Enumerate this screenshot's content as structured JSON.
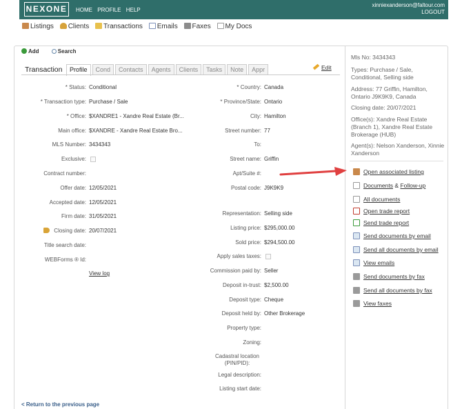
{
  "header": {
    "logo": "NEXONE",
    "nav": [
      "HOME",
      "PROFILE",
      "HELP"
    ],
    "user_email": "xinniexanderson@faltour.com",
    "logout": "LOGOUT"
  },
  "modules": [
    {
      "label": "Listings",
      "icon": "house-icon"
    },
    {
      "label": "Clients",
      "icon": "person-icon"
    },
    {
      "label": "Transactions",
      "icon": "folder-icon"
    },
    {
      "label": "Emails",
      "icon": "mail-icon"
    },
    {
      "label": "Faxes",
      "icon": "fax-icon"
    },
    {
      "label": "My Docs",
      "icon": "documents-icon"
    }
  ],
  "toolbar": {
    "add": "Add",
    "search": "Search"
  },
  "tabs": {
    "title": "Transaction",
    "items": [
      "Profile",
      "Cond",
      "Contacts",
      "Agents",
      "Clients",
      "Tasks",
      "Note",
      "Appr"
    ],
    "active": "Profile",
    "edit": "Edit"
  },
  "left_fields": [
    {
      "label": "* Status:",
      "value": "Conditional"
    },
    {
      "label": "* Transaction type:",
      "value": "Purchase / Sale"
    },
    {
      "label": "* Office:",
      "value": "$XANDRE1 - Xandre Real Estate (Br..."
    },
    {
      "label": "Main office:",
      "value": "$XANDRE - Xandre Real Estate Bro..."
    },
    {
      "label": "MLS Number:",
      "value": "3434343"
    },
    {
      "label": "Exclusive:",
      "value": ""
    },
    {
      "label": "Contract number:",
      "value": ""
    },
    {
      "label": "Offer date:",
      "value": "12/05/2021"
    },
    {
      "label": "Accepted date:",
      "value": "12/05/2021"
    },
    {
      "label": "Firm date:",
      "value": "31/05/2021"
    },
    {
      "label": "Closing date:",
      "value": "20/07/2021"
    },
    {
      "label": "Title search date:",
      "value": ""
    },
    {
      "label": "WEBForms ® Id:",
      "value": ""
    }
  ],
  "view_log": "View log",
  "right_fields": [
    {
      "label": "* Country:",
      "value": "Canada"
    },
    {
      "label": "* Province/State:",
      "value": "Ontario"
    },
    {
      "label": "City:",
      "value": "Hamilton"
    },
    {
      "label": "Street number:",
      "value": "77"
    },
    {
      "label": "To:",
      "value": ""
    },
    {
      "label": "Street name:",
      "value": "Griffin"
    },
    {
      "label": "Apt/Suite #:",
      "value": ""
    },
    {
      "label": "Postal code:",
      "value": "J9K9K9"
    },
    {
      "label": "Representation:",
      "value": "Selling side"
    },
    {
      "label": "Listing price:",
      "value": "$295,000.00"
    },
    {
      "label": "Sold price:",
      "value": "$294,500.00"
    },
    {
      "label": "Apply sales taxes:",
      "value": ""
    },
    {
      "label": "Commission paid by:",
      "value": "Seller"
    },
    {
      "label": "Deposit in-trust:",
      "value": "$2,500.00"
    },
    {
      "label": "Deposit type:",
      "value": "Cheque"
    },
    {
      "label": "Deposit held by:",
      "value": "Other Brokerage"
    },
    {
      "label": "Property type:",
      "value": ""
    },
    {
      "label": "Zoning:",
      "value": ""
    },
    {
      "label": "Cadastral location (PIN/PID):",
      "value": ""
    },
    {
      "label": "Legal description:",
      "value": ""
    },
    {
      "label": "Listing start date:",
      "value": ""
    }
  ],
  "back_link": "< Return to the previous page",
  "summary": {
    "mls": "Mls No:  3434343",
    "types": "Types:  Purchase / Sale, Conditional, Selling side",
    "address": "Address:  77 Griffin, Hamilton, Ontario J9K9K9, Canada",
    "closing": "Closing date:  20/07/2021",
    "offices": "Office(s):  Xandre Real Estate (Branch 1), Xandre Real Estate Brokerage (HUB)",
    "agents": "Agent(s):  Nelson Xanderson, Xinnie Xanderson"
  },
  "actions": {
    "open_listing": "Open associated listing",
    "documents": "Documents",
    "amp": "&",
    "follow_up": "Follow-up",
    "all_documents": "All documents",
    "open_trade_report": "Open trade report",
    "send_trade_report": "Send trade report",
    "send_docs_email": "Send documents by email",
    "send_all_docs_email": "Send all documents by email",
    "view_emails": "View emails",
    "send_docs_fax": "Send documents by fax",
    "send_all_docs_fax": "Send all documents by fax",
    "view_faxes": "View faxes"
  },
  "colors": {
    "header": "#2f6e6a",
    "arrow": "#e04040"
  }
}
